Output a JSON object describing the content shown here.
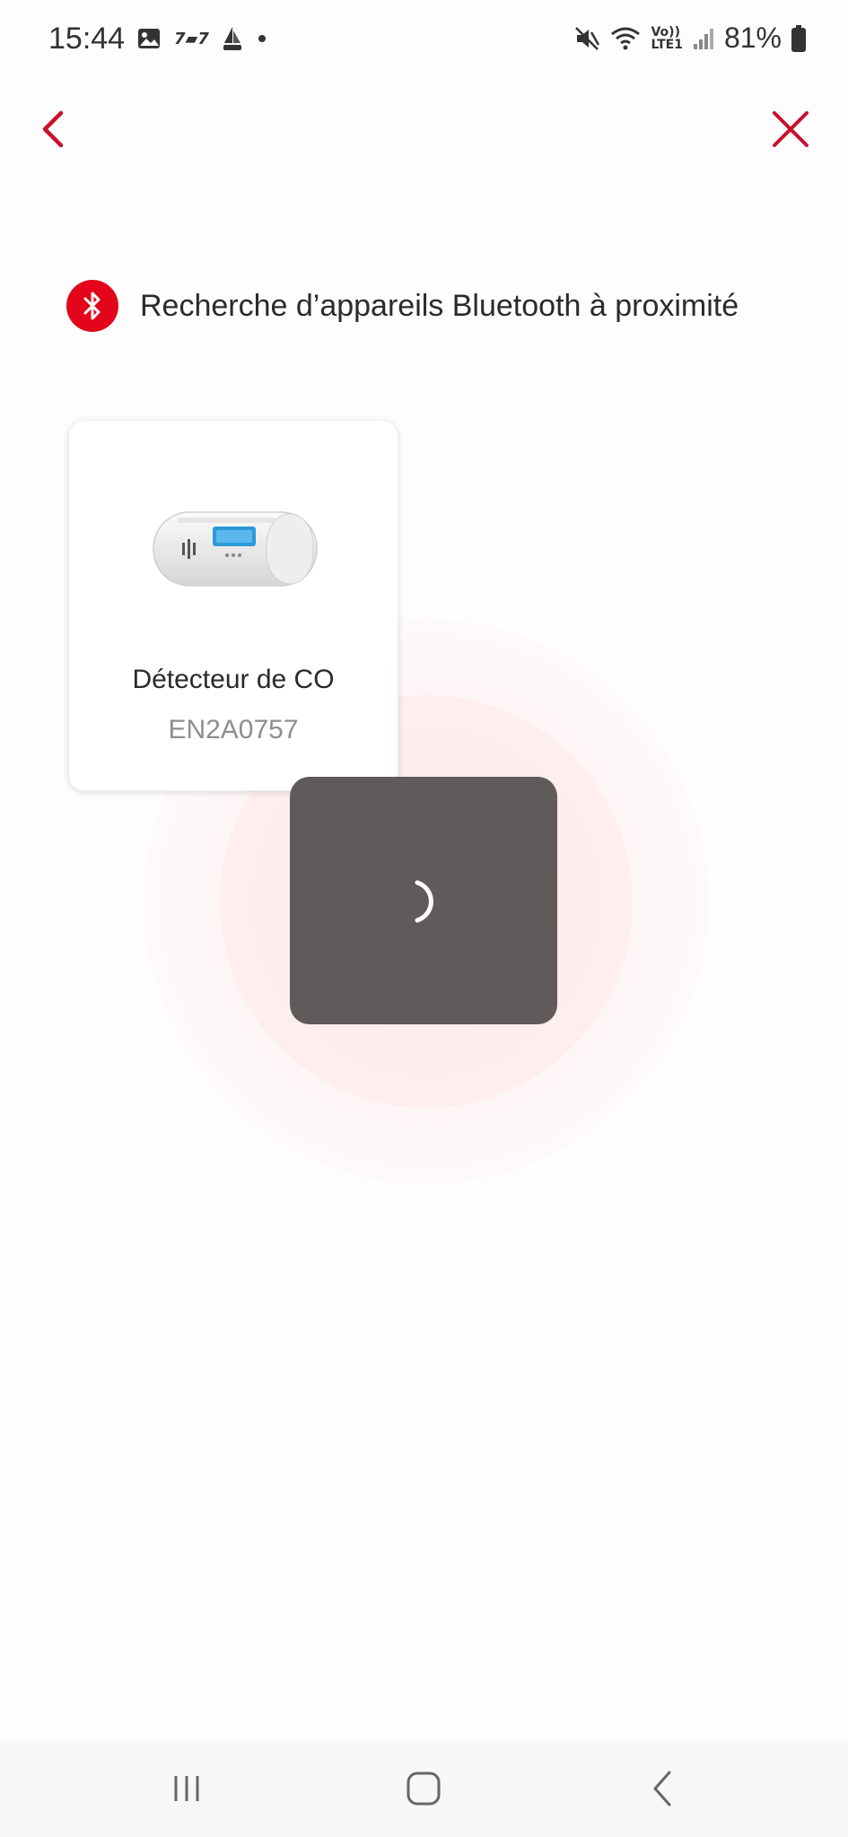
{
  "status_bar": {
    "time": "15:44",
    "battery": "81%",
    "notification_label": "7▰7",
    "network_label_top": "Vo))",
    "network_label_bottom": "LTE1"
  },
  "nav": {
    "back_icon": "chevron-left-icon",
    "close_icon": "close-icon"
  },
  "scan": {
    "title": "Recherche d’appareils Bluetooth à proximité",
    "icon": "bluetooth-icon"
  },
  "devices": [
    {
      "name": "Détecteur de CO",
      "serial": "EN2A0757"
    }
  ],
  "colors": {
    "accent": "#e3061a",
    "overlay": "#605a5b"
  },
  "loading": {
    "visible": true
  },
  "system_nav": {
    "recents": "recents-icon",
    "home": "home-icon",
    "back": "back-icon"
  }
}
